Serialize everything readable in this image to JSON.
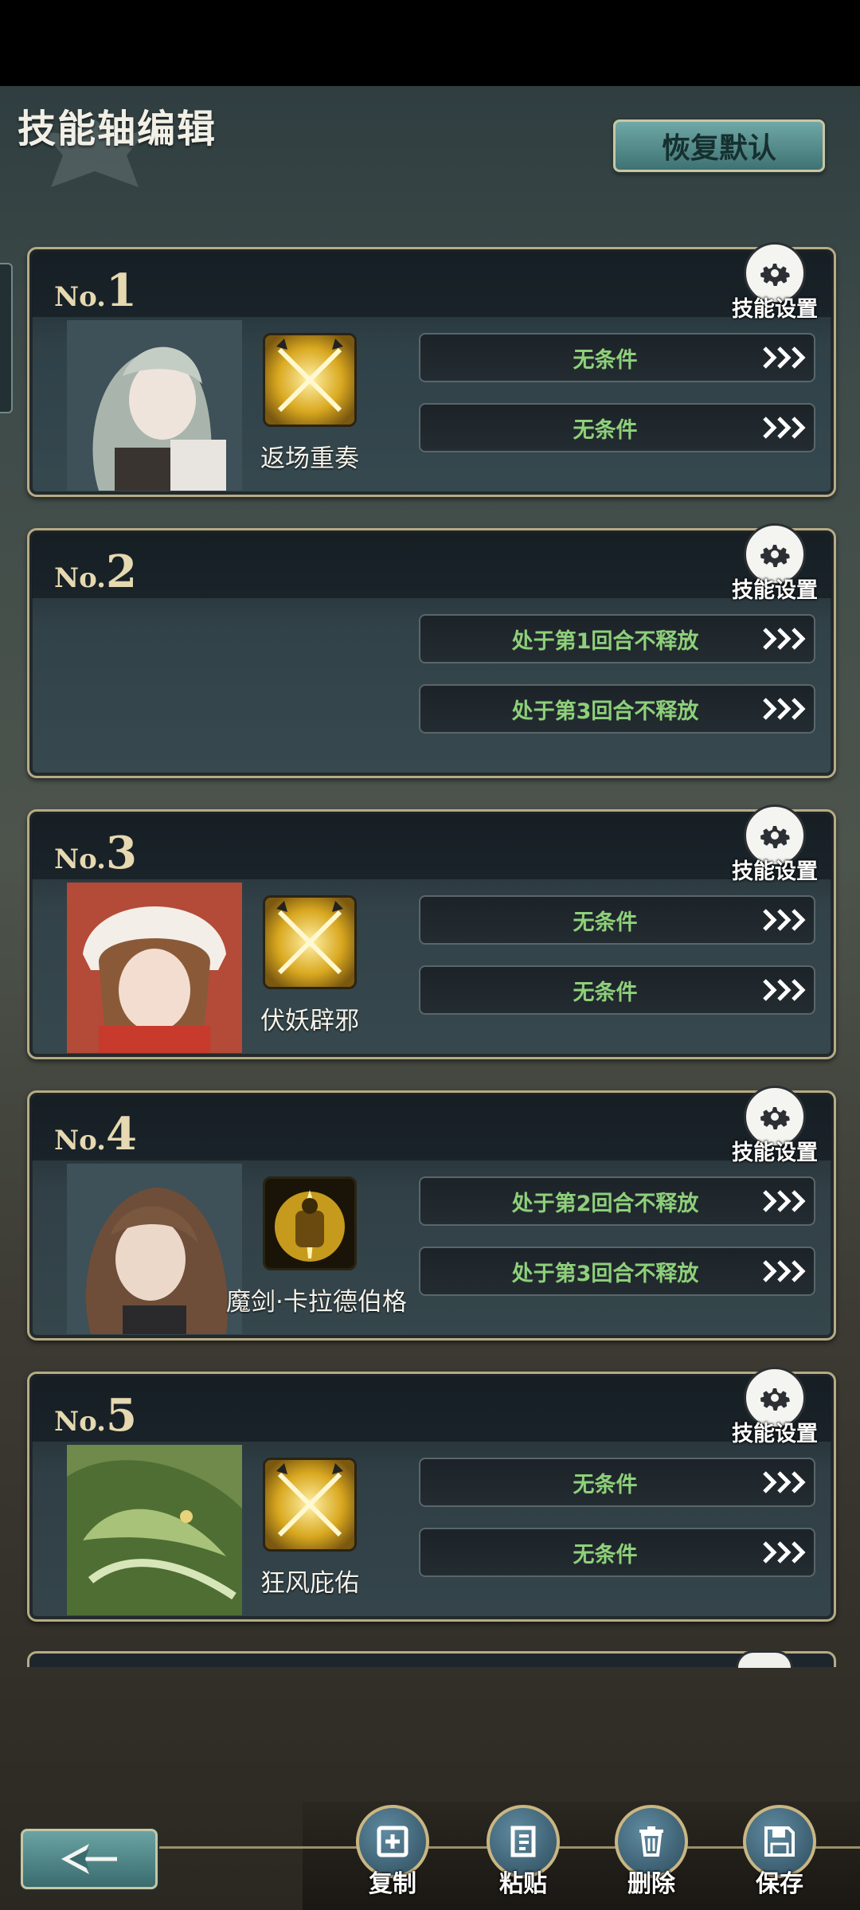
{
  "header": {
    "title": "技能轴编辑",
    "reset_label": "恢复默认"
  },
  "gear_label": "技能设置",
  "cards": [
    {
      "no_prefix": "No.",
      "number": "1",
      "skill_name": "返场重奏",
      "conditions": [
        "无条件",
        "无条件"
      ]
    },
    {
      "no_prefix": "No.",
      "number": "2",
      "skill_name": "",
      "conditions": [
        "处于第1回合不释放",
        "处于第3回合不释放"
      ]
    },
    {
      "no_prefix": "No.",
      "number": "3",
      "skill_name": "伏妖辟邪",
      "conditions": [
        "无条件",
        "无条件"
      ]
    },
    {
      "no_prefix": "No.",
      "number": "4",
      "skill_name": "魔剑·卡拉德伯格",
      "conditions": [
        "处于第2回合不释放",
        "处于第3回合不释放"
      ]
    },
    {
      "no_prefix": "No.",
      "number": "5",
      "skill_name": "狂风庇佑",
      "conditions": [
        "无条件",
        "无条件"
      ]
    }
  ],
  "actions": {
    "copy": "复制",
    "paste": "粘贴",
    "delete": "删除",
    "save": "保存"
  },
  "colors": {
    "condition_text": "#8ed07a",
    "frame_gold": "#b7ab86",
    "button_teal": "#4f8a8a"
  }
}
